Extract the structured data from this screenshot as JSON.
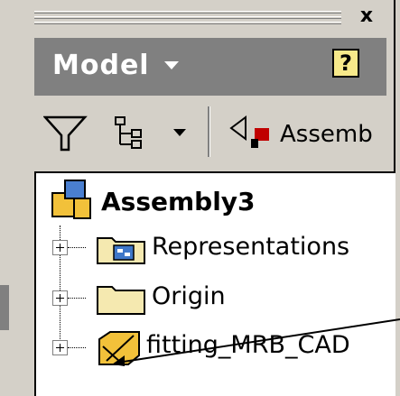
{
  "browser": {
    "title": "Model",
    "help_label": "?",
    "close_label": "x"
  },
  "toolbar": {
    "assembly_label": "Assemb"
  },
  "tree": {
    "root_label": "Assembly3",
    "items": [
      {
        "label": "Representations",
        "icon": "representations-folder-icon"
      },
      {
        "label": "Origin",
        "icon": "folder-icon"
      },
      {
        "label": "fitting_MRB_CAD",
        "icon": "part-missing-icon"
      }
    ]
  },
  "colors": {
    "header_bg": "#808080",
    "panel_bg": "#d4d0c8",
    "tree_bg": "#ffffff",
    "help_bg": "#f7e98a"
  }
}
